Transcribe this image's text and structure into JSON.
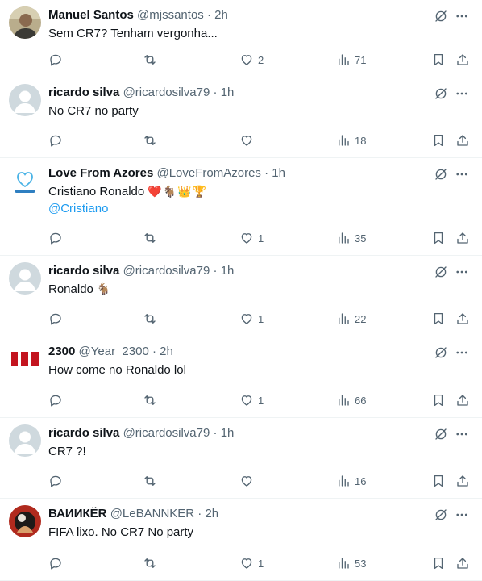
{
  "accent_color": "#1d9bf0",
  "text_color": "#0f1419",
  "muted_color": "#536471",
  "separator": "·",
  "tweets": [
    {
      "avatar": "photo-man",
      "name": "Manuel Santos",
      "handle": "@mjssantos",
      "time": "2h",
      "text": "Sem CR7? Tenham vergonha...",
      "emoji": "",
      "mention": "",
      "replies": "",
      "retweets": "",
      "likes": "2",
      "views": "71"
    },
    {
      "avatar": "default-avatar",
      "name": "ricardo silva",
      "handle": "@ricardosilva79",
      "time": "1h",
      "text": "No CR7 no party",
      "emoji": "",
      "mention": "",
      "replies": "",
      "retweets": "",
      "likes": "",
      "views": "18"
    },
    {
      "avatar": "azores-logo",
      "name": "Love From Azores",
      "handle": "@LoveFromAzores",
      "time": "1h",
      "text": "Cristiano Ronaldo",
      "emoji": "❤️🐐👑🏆",
      "mention": "@Cristiano",
      "replies": "",
      "retweets": "",
      "likes": "1",
      "views": "35"
    },
    {
      "avatar": "default-avatar",
      "name": "ricardo silva",
      "handle": "@ricardosilva79",
      "time": "1h",
      "text": "Ronaldo",
      "emoji": "🐐",
      "mention": "",
      "replies": "",
      "retweets": "",
      "likes": "1",
      "views": "22"
    },
    {
      "avatar": "red-2300-logo",
      "name": "2300",
      "handle": "@Year_2300",
      "time": "2h",
      "text": "How come no Ronaldo lol",
      "emoji": "",
      "mention": "",
      "replies": "",
      "retweets": "",
      "likes": "1",
      "views": "66"
    },
    {
      "avatar": "default-avatar",
      "name": "ricardo silva",
      "handle": "@ricardosilva79",
      "time": "1h",
      "text": "CR7 ?!",
      "emoji": "",
      "mention": "",
      "replies": "",
      "retweets": "",
      "likes": "",
      "views": "16"
    },
    {
      "avatar": "photo-ball",
      "name": "ВАИИКЁR",
      "handle": "@LeBANNKER",
      "time": "2h",
      "text": "FIFA lixo. No CR7 No party",
      "emoji": "",
      "mention": "",
      "replies": "",
      "retweets": "",
      "likes": "1",
      "views": "53"
    }
  ]
}
